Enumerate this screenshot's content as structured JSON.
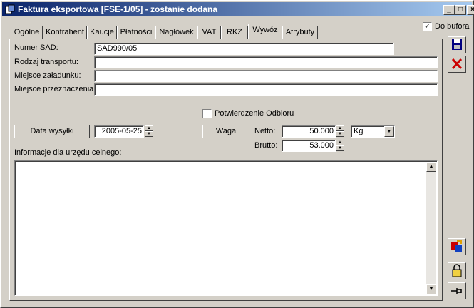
{
  "window": {
    "title": "Faktura eksportowa [FSE-1/05]  - zostanie dodana",
    "minimize_label": "_",
    "maximize_label": "□",
    "close_label": "×"
  },
  "tabs": [
    "Ogólne",
    "Kontrahent",
    "Kaucje",
    "Płatności",
    "Nagłówek",
    "VAT",
    "RKZ",
    "Wywóz",
    "Atrybuty"
  ],
  "active_tab": "Wywóz",
  "do_bufora": {
    "label": "Do bufora",
    "checked": true
  },
  "form": {
    "numer_sad": {
      "label": "Numer SAD:",
      "value": "SAD990/05"
    },
    "rodzaj_transportu": {
      "label": "Rodzaj transportu:",
      "value": ""
    },
    "miejsce_zaladunku": {
      "label": "Miejsce załadunku:",
      "value": ""
    },
    "miejsce_przeznaczenia": {
      "label": "Miejsce przeznaczenia:",
      "value": ""
    },
    "potwierdzenie_odbioru": {
      "label": "Potwierdzenie Odbioru",
      "checked": false
    },
    "data_wysylki_button": "Data wysyłki",
    "data_wysylki_value": "2005-05-25",
    "waga_button": "Waga",
    "netto_label": "Netto:",
    "netto_value": "50.000",
    "brutto_label": "Brutto:",
    "brutto_value": "53.000",
    "unit": "Kg",
    "informacje_label": "Informacje dla urzędu celnego:",
    "informacje_value": ""
  },
  "side_buttons": [
    "save-icon",
    "cancel-icon",
    "refresh-icon",
    "lock-icon",
    "pin-icon"
  ],
  "colors": {
    "titlebar_start": "#0a246a",
    "titlebar_end": "#a6caf0",
    "face": "#d4d0c8",
    "cancel_red": "#cc0000",
    "save_blue": "#000080"
  }
}
